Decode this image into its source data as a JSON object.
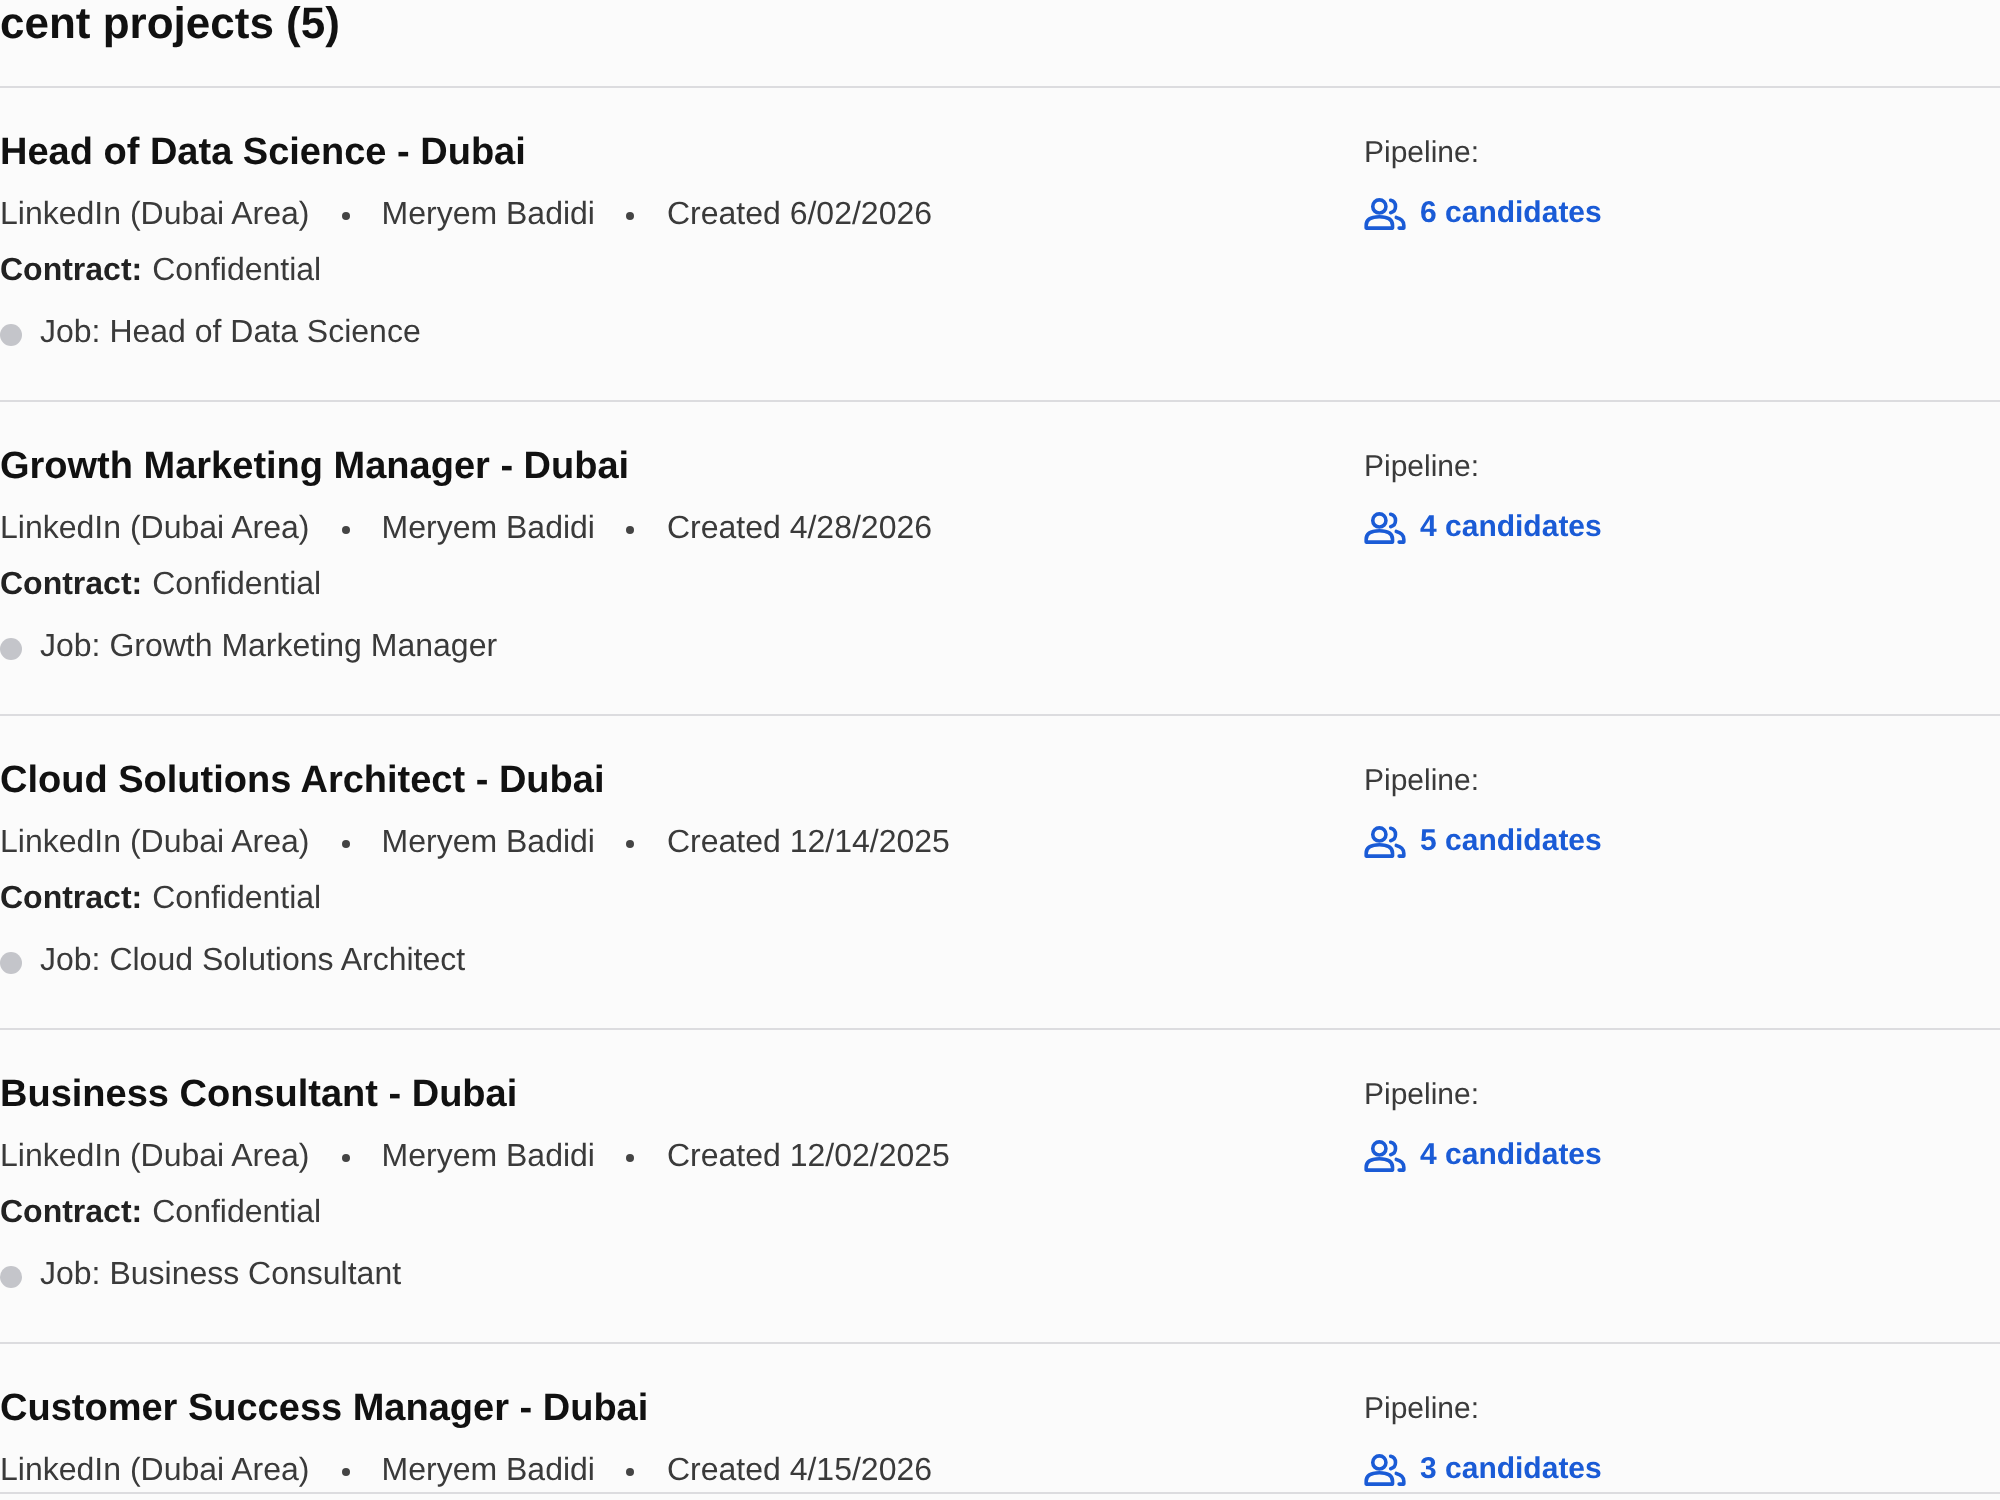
{
  "heading": "cent projects (5)",
  "projects": [
    {
      "title": "Head of Data Science - Dubai",
      "source": "LinkedIn (Dubai Area)",
      "owner": "Meryem Badidi",
      "created": "Created 6/02/2026",
      "contract": {
        "label": "Contract:",
        "value": "Confidential"
      },
      "job": "Job: Head of Data Science",
      "pipeline_label": "Pipeline:",
      "candidates": "6 candidates"
    },
    {
      "title": "Growth Marketing Manager - Dubai",
      "source": "LinkedIn (Dubai Area)",
      "owner": "Meryem Badidi",
      "created": "Created 4/28/2026",
      "contract": {
        "label": "Contract:",
        "value": "Confidential"
      },
      "job": "Job: Growth Marketing Manager",
      "pipeline_label": "Pipeline:",
      "candidates": "4 candidates"
    },
    {
      "title": "Cloud Solutions Architect - Dubai",
      "source": "LinkedIn (Dubai Area)",
      "owner": "Meryem Badidi",
      "created": "Created 12/14/2025",
      "contract": {
        "label": "Contract:",
        "value": "Confidential"
      },
      "job": "Job: Cloud Solutions Architect",
      "pipeline_label": "Pipeline:",
      "candidates": "5 candidates"
    },
    {
      "title": "Business Consultant - Dubai",
      "source": "LinkedIn (Dubai Area)",
      "owner": "Meryem Badidi",
      "created": "Created 12/02/2025",
      "contract": {
        "label": "Contract:",
        "value": "Confidential"
      },
      "job": "Job: Business Consultant",
      "pipeline_label": "Pipeline:",
      "candidates": "4 candidates"
    },
    {
      "title": "Customer Success Manager - Dubai",
      "source": "LinkedIn (Dubai Area)",
      "owner": "Meryem Badidi",
      "created": "Created 4/15/2026",
      "pipeline_label": "Pipeline:",
      "candidates": "3 candidates"
    }
  ]
}
